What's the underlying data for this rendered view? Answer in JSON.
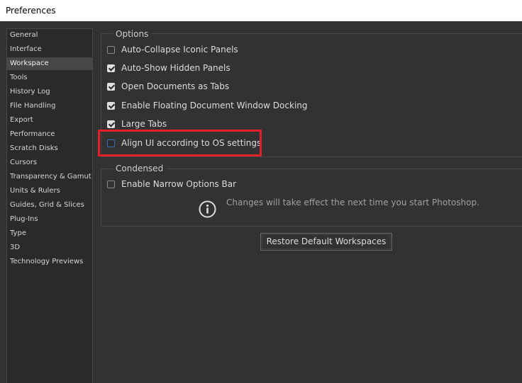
{
  "window": {
    "title": "Preferences"
  },
  "sidebar": {
    "items": [
      {
        "label": "General"
      },
      {
        "label": "Interface"
      },
      {
        "label": "Workspace",
        "active": true
      },
      {
        "label": "Tools"
      },
      {
        "label": "History Log"
      },
      {
        "label": "File Handling"
      },
      {
        "label": "Export"
      },
      {
        "label": "Performance"
      },
      {
        "label": "Scratch Disks"
      },
      {
        "label": "Cursors"
      },
      {
        "label": "Transparency & Gamut"
      },
      {
        "label": "Units & Rulers"
      },
      {
        "label": "Guides, Grid & Slices"
      },
      {
        "label": "Plug-Ins"
      },
      {
        "label": "Type"
      },
      {
        "label": "3D"
      },
      {
        "label": "Technology Previews"
      }
    ]
  },
  "options": {
    "title": "Options",
    "items": [
      {
        "label": "Auto-Collapse Iconic Panels",
        "checked": false
      },
      {
        "label": "Auto-Show Hidden Panels",
        "checked": true
      },
      {
        "label": "Open Documents as Tabs",
        "checked": true
      },
      {
        "label": "Enable Floating Document Window Docking",
        "checked": true
      },
      {
        "label": "Large Tabs",
        "checked": true
      },
      {
        "label": "Align UI according to OS settings",
        "checked": false,
        "focused": true
      }
    ]
  },
  "condensed": {
    "title": "Condensed",
    "items": [
      {
        "label": "Enable Narrow Options Bar",
        "checked": false
      }
    ],
    "notice": "Changes will take effect the next time you start Photoshop."
  },
  "buttons": {
    "restore": "Restore Default Workspaces"
  },
  "colors": {
    "background": "#323232",
    "sidebar": "#2a2a2a",
    "active_item": "#474747",
    "highlight": "#e0202a",
    "focus": "#3d6fb6"
  },
  "icons": {
    "info": "info-icon"
  }
}
